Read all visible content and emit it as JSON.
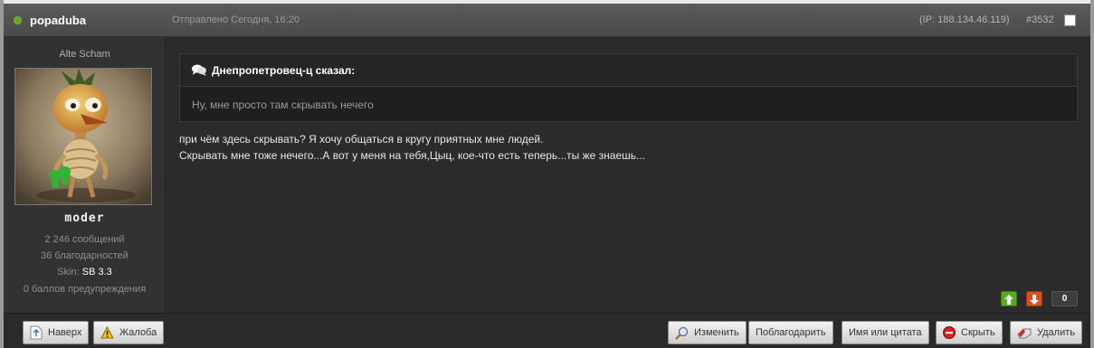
{
  "post": {
    "author": "popaduba",
    "posted": "Отправлено Сегодня, 16:20",
    "ip": "(IP: 188.134.46.119)",
    "number": "#3532"
  },
  "user": {
    "title": "Alte Scham",
    "rank": "moder",
    "posts": "2 246 сообщений",
    "thanks": "36 благодарностей",
    "skin_label": "Skin:",
    "skin_value": "SB 3.3",
    "warnings": "0 баллов предупреждения"
  },
  "quote": {
    "author": "Днепропетровец-ц сказал:",
    "text": "Ну, мне просто там скрывать нечего"
  },
  "message": {
    "line1": "при чём здесь скрывать? Я хочу общаться в кругу приятных мне людей.",
    "line2": "Скрывать мне тоже нечего...А вот у меня на тебя,Цыц, кое-что есть теперь...ты же знаешь..."
  },
  "rating": {
    "count": "0"
  },
  "footer": {
    "top": "Наверх",
    "report": "Жалоба",
    "edit": "Изменить",
    "thank": "Поблагодарить",
    "name_quote": "Имя или цитата",
    "hide": "Скрыть",
    "delete": "Удалить"
  },
  "colors": {
    "online": "#5ea71f",
    "rate_up": "#5aa923",
    "rate_down": "#d8531b"
  }
}
